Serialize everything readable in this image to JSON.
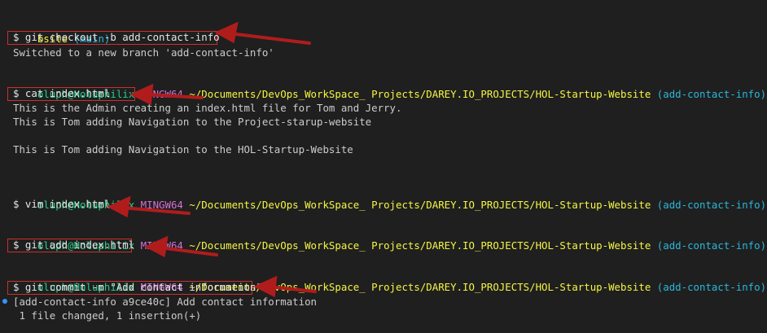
{
  "terminal": {
    "branch_line": {
      "dir": "bsite",
      "branch": "(main)"
    },
    "commands": [
      {
        "prompt": "$ git checkout -b add-contact-info"
      },
      {
        "prompt": "$ cat index.html"
      },
      {
        "prompt": "$ vim index.html"
      },
      {
        "prompt": "$ git add index.html"
      },
      {
        "prompt": "$ git commit -m \"Add contact information\""
      }
    ],
    "outputs": {
      "checkout": "Switched to a new branch 'add-contact-info'",
      "cat_1": "This is the Admin creating an index.html file for Tom and Jerry.",
      "cat_2": "This is Tom adding Navigation to the Project-starup-website",
      "cat_3": "This is Tom adding Navigation to the HOL-Startup-Website",
      "commit_1": "[add-contact-info a9ce40c] Add contact information",
      "commit_2": " 1 file changed, 1 insertion(+)"
    },
    "prompt_header": {
      "user_host": "oluph@Holuphilix",
      "shell": "MINGW64",
      "path": "~/Documents/DevOps_WorkSpace_ Projects/DAREY.IO_PROJECTS/HOL-Startup-Website",
      "branch": "(add-contact-info)"
    }
  },
  "colors": {
    "background": "#1f1f1f",
    "user_host": "#23d18b",
    "shell": "#d670d6",
    "path": "#f5f543",
    "branch": "#29b8db",
    "annotation": "#b01c1c"
  }
}
